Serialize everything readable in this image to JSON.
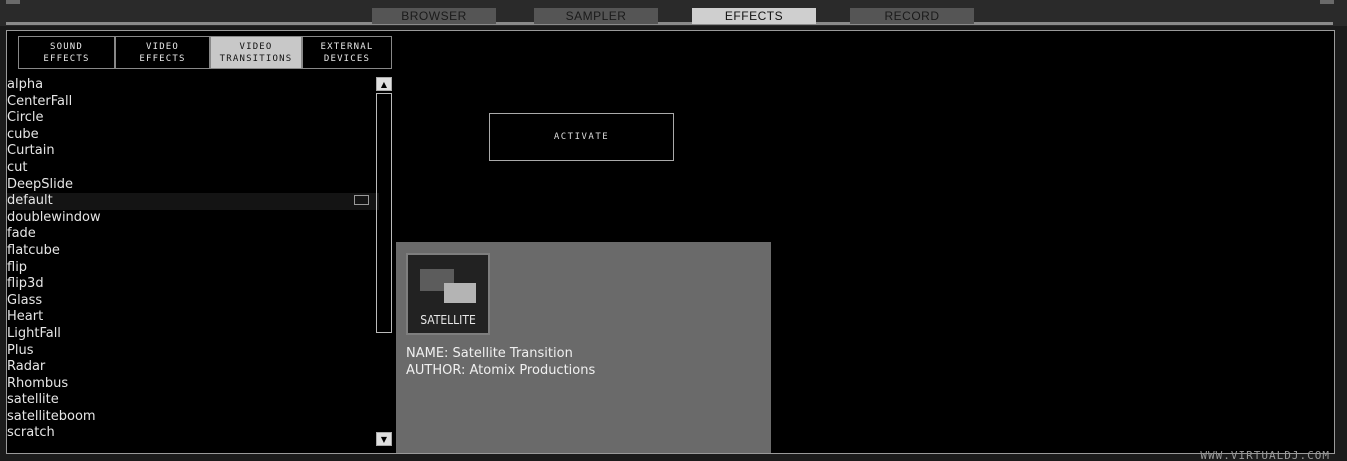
{
  "top_tabs": [
    {
      "label": "BROWSER",
      "active": false
    },
    {
      "label": "SAMPLER",
      "active": false
    },
    {
      "label": "EFFECTS",
      "active": true
    },
    {
      "label": "RECORD",
      "active": false
    }
  ],
  "sub_tabs": [
    {
      "line1": "SOUND",
      "line2": "EFFECTS",
      "active": false
    },
    {
      "line1": "VIDEO",
      "line2": "EFFECTS",
      "active": false
    },
    {
      "line1": "VIDEO",
      "line2": "TRANSITIONS",
      "active": true
    },
    {
      "line1": "EXTERNAL",
      "line2": "DEVICES",
      "active": false
    }
  ],
  "transitions": [
    "alpha",
    "CenterFall",
    "Circle",
    "cube",
    "Curtain",
    "cut",
    "DeepSlide",
    "default",
    "doublewindow",
    "fade",
    "flatcube",
    "flip",
    "flip3d",
    "Glass",
    "Heart",
    "LightFall",
    "Plus",
    "Radar",
    "Rhombus",
    "satellite",
    "satelliteboom",
    "scratch"
  ],
  "selected_transition": "default",
  "activate_label": "ACTIVATE",
  "info": {
    "thumb_label": "SATELLITE",
    "name_line": "NAME: Satellite Transition",
    "author_line": "AUTHOR: Atomix Productions"
  },
  "watermark": "WWW.VIRTUALDJ.COM",
  "icons": {
    "scroll_up": "triangle-up",
    "scroll_down": "triangle-down"
  }
}
